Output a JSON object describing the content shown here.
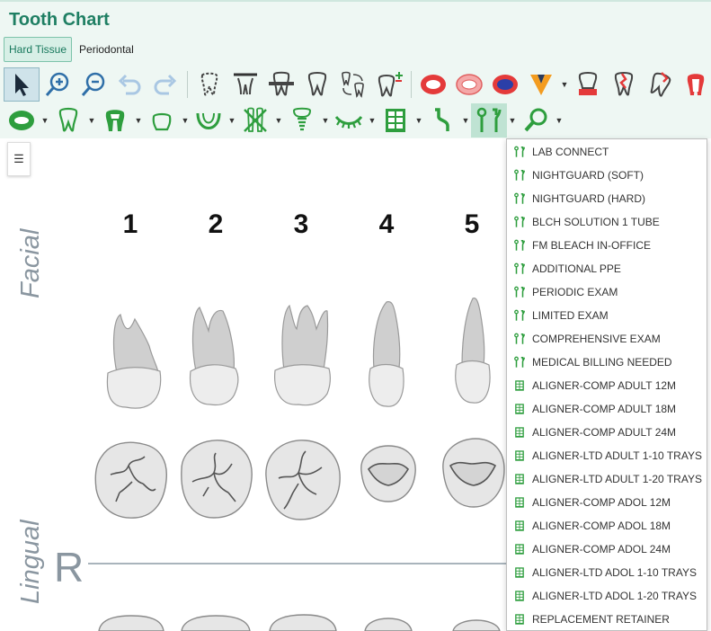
{
  "header": {
    "title": "Tooth Chart",
    "tabs": [
      {
        "label": "Hard Tissue",
        "active": true
      },
      {
        "label": "Periodontal",
        "active": false
      }
    ]
  },
  "toolbar": {
    "row1_icons": [
      "select-pointer-icon",
      "zoom-in-icon",
      "zoom-out-icon",
      "undo-icon",
      "redo-icon",
      "missing-tooth-icon",
      "extraction-icon",
      "bridge-icon",
      "tooth-outline-icon",
      "tooth-swap-icon",
      "tooth-add-icon",
      "red-filling-icon",
      "pink-filling-icon",
      "blue-filling-icon",
      "orange-flag-icon",
      "crown-root-icon",
      "fracture-tooth-icon",
      "broken-tooth-icon",
      "root-canal-icon"
    ],
    "row2_icons": [
      "sealant-icon",
      "tooth-green-icon",
      "crown-dark-icon",
      "tooth-small-icon",
      "arch-icon",
      "cross-teeth-icon",
      "implant-icon",
      "eyelash-icon",
      "grid-panel-icon",
      "probe-icon",
      "lab-tools-icon",
      "search-tools-icon"
    ],
    "accent": "#2e9e3e"
  },
  "list_toggle_icon": "list-icon",
  "chart": {
    "facial_label": "Facial",
    "lingual_label": "Lingual",
    "teeth_numbers": [
      "1",
      "2",
      "3",
      "4",
      "5"
    ],
    "quadrant_label": "R"
  },
  "dropdown": {
    "items": [
      {
        "label": "LAB CONNECT",
        "icon": "lab-tools-icon"
      },
      {
        "label": "NIGHTGUARD (SOFT)",
        "icon": "lab-tools-icon"
      },
      {
        "label": "NIGHTGUARD (HARD)",
        "icon": "lab-tools-icon"
      },
      {
        "label": "BLCH SOLUTION 1 TUBE",
        "icon": "lab-tools-icon"
      },
      {
        "label": "FM BLEACH IN-OFFICE",
        "icon": "lab-tools-icon"
      },
      {
        "label": "ADDITIONAL PPE",
        "icon": "lab-tools-icon"
      },
      {
        "label": "PERIODIC EXAM",
        "icon": "lab-tools-icon"
      },
      {
        "label": "LIMITED EXAM",
        "icon": "lab-tools-icon"
      },
      {
        "label": "COMPREHENSIVE EXAM",
        "icon": "lab-tools-icon"
      },
      {
        "label": "MEDICAL BILLING NEEDED",
        "icon": "lab-tools-icon"
      },
      {
        "label": "ALIGNER-COMP ADULT 12M",
        "icon": "grid-panel-icon"
      },
      {
        "label": "ALIGNER-COMP ADULT 18M",
        "icon": "grid-panel-icon"
      },
      {
        "label": "ALIGNER-COMP ADULT 24M",
        "icon": "grid-panel-icon"
      },
      {
        "label": "ALIGNER-LTD ADULT 1-10 TRAYS",
        "icon": "grid-panel-icon"
      },
      {
        "label": "ALIGNER-LTD ADULT 1-20 TRAYS",
        "icon": "grid-panel-icon"
      },
      {
        "label": "ALIGNER-COMP ADOL 12M",
        "icon": "grid-panel-icon"
      },
      {
        "label": "ALIGNER-COMP ADOL 18M",
        "icon": "grid-panel-icon"
      },
      {
        "label": "ALIGNER-COMP ADOL 24M",
        "icon": "grid-panel-icon"
      },
      {
        "label": "ALIGNER-LTD ADOL 1-10 TRAYS",
        "icon": "grid-panel-icon"
      },
      {
        "label": "ALIGNER-LTD ADOL 1-20 TRAYS",
        "icon": "grid-panel-icon"
      },
      {
        "label": "REPLACEMENT RETAINER",
        "icon": "grid-panel-icon"
      }
    ]
  }
}
